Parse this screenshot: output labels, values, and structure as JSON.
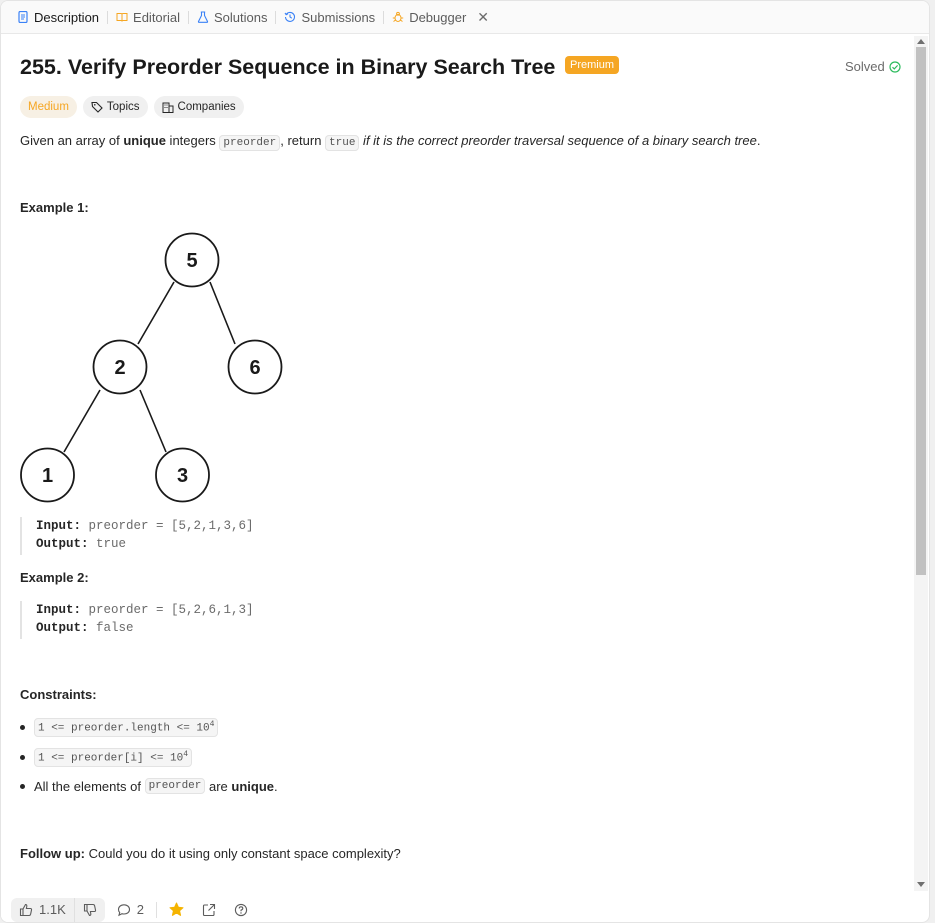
{
  "tabs": [
    {
      "label": "Description",
      "icon": "description-icon"
    },
    {
      "label": "Editorial",
      "icon": "book-icon"
    },
    {
      "label": "Solutions",
      "icon": "flask-icon"
    },
    {
      "label": "Submissions",
      "icon": "history-icon"
    },
    {
      "label": "Debugger",
      "icon": "bug-icon"
    }
  ],
  "problem": {
    "title": "255. Verify Preorder Sequence in Binary Search Tree",
    "premium_badge": "Premium",
    "status": "Solved",
    "difficulty": "Medium",
    "topics_label": "Topics",
    "companies_label": "Companies",
    "desc_part1": "Given an array of ",
    "desc_bold": "unique",
    "desc_part2": " integers ",
    "desc_code1": "preorder",
    "desc_part3": ", return ",
    "desc_code2": "true",
    "desc_italic": " if it is the correct preorder traversal sequence of a binary search tree",
    "desc_end": "."
  },
  "example1": {
    "heading": "Example 1:",
    "tree_nodes": [
      "5",
      "2",
      "6",
      "1",
      "3"
    ],
    "input_label": "Input:",
    "input_value": " preorder = [5,2,1,3,6]",
    "output_label": "Output:",
    "output_value": " true"
  },
  "example2": {
    "heading": "Example 2:",
    "input_label": "Input:",
    "input_value": " preorder = [5,2,6,1,3]",
    "output_label": "Output:",
    "output_value": " false"
  },
  "constraints": {
    "heading": "Constraints:",
    "c1_code": "1 <= preorder.length <= 10",
    "c1_sup": "4",
    "c2_code": "1 <= preorder[i] <= 10",
    "c2_sup": "4",
    "c3_part1": "All the elements of ",
    "c3_code": "preorder",
    "c3_part2": " are ",
    "c3_bold": "unique",
    "c3_end": "."
  },
  "followup": {
    "label": "Follow up:",
    "text": " Could you do it using only constant space complexity?"
  },
  "bottom": {
    "likes": "1.1K",
    "comments": "2"
  },
  "colors": {
    "premium": "#f5a623",
    "medium": "#f5a623",
    "solved": "#2cbb5d",
    "favorite": "#f5b400",
    "description_icon": "#3b82f6"
  }
}
